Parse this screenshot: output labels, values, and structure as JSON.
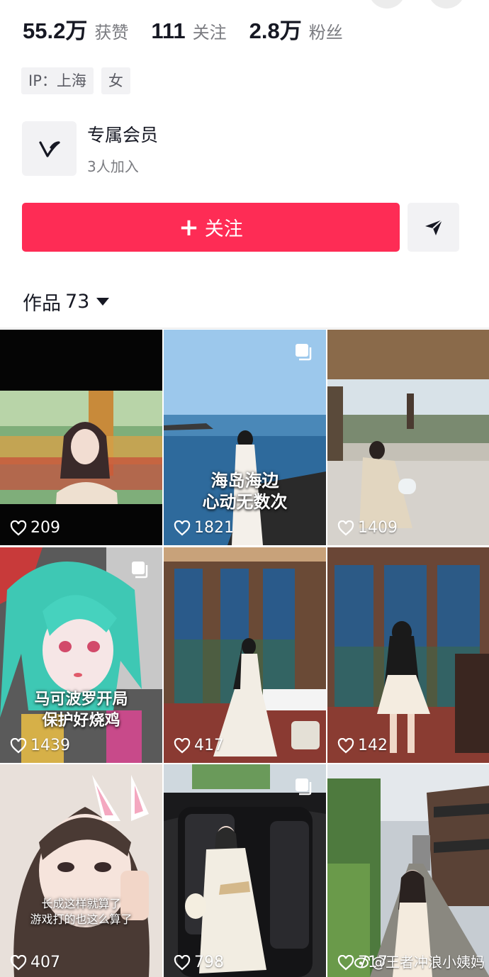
{
  "stats": [
    {
      "value": "55.2万",
      "label": "获赞"
    },
    {
      "value": "111",
      "label": "关注"
    },
    {
      "value": "2.8万",
      "label": "粉丝"
    }
  ],
  "tags": [
    "IP：上海",
    "女"
  ],
  "member": {
    "title": "专属会员",
    "subtitle": "3人加入",
    "icon": "v-logo-icon"
  },
  "actions": {
    "follow_label": "关注",
    "follow_icon": "plus-icon",
    "share_icon": "send-icon"
  },
  "works": {
    "label": "作品",
    "count": "73"
  },
  "videos": [
    {
      "likes": "209",
      "overlay": [],
      "multi": false
    },
    {
      "likes": "1821",
      "overlay": [
        "海岛海边",
        "心动无数次"
      ],
      "multi": true
    },
    {
      "likes": "1409",
      "overlay": [],
      "multi": false
    },
    {
      "likes": "1439",
      "overlay": [
        "马可波罗开局",
        "保护好烧鸡"
      ],
      "multi": true
    },
    {
      "likes": "417",
      "overlay": [],
      "multi": false
    },
    {
      "likes": "142",
      "overlay": [],
      "multi": false
    },
    {
      "likes": "407",
      "overlay": [
        "长成这样就算了",
        "游戏打的也这么算了"
      ],
      "multi": false
    },
    {
      "likes": "798",
      "overlay": [],
      "multi": true
    },
    {
      "likes": "717",
      "overlay": [],
      "multi": false
    }
  ],
  "watermark": "@王者冲浪小姨妈",
  "colors": {
    "accent": "#fe2c55",
    "text": "#161823",
    "muted": "#7a7b80"
  }
}
